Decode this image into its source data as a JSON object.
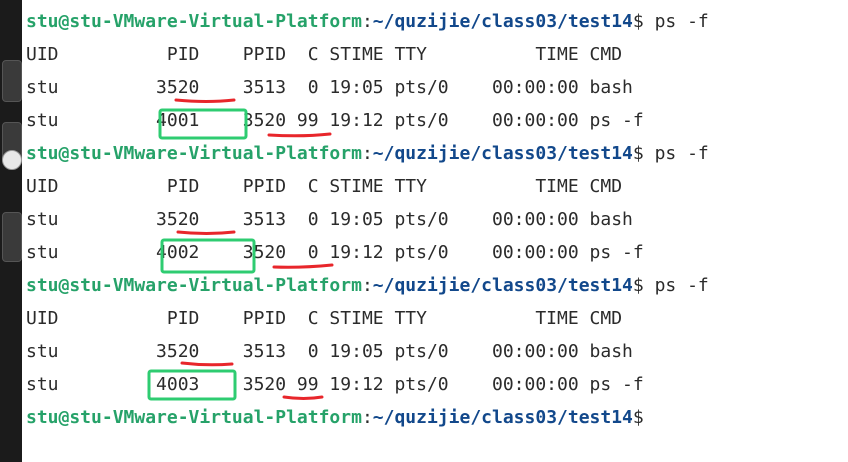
{
  "colors": {
    "background": "#ffffff",
    "text": "#2b2b2b",
    "prompt_user": "#26a269",
    "prompt_path": "#12488b",
    "underline_red": "#e8262b",
    "box_green": "#2ecc71",
    "dock": "#1b1b1b"
  },
  "prompt": {
    "user_host": "stu@stu-VMware-Virtual-Platform",
    "sep": ":",
    "path": "~/quzijie/class03/test14",
    "symbol": "$"
  },
  "blocks": [
    {
      "command": " ps -f",
      "header": "UID          PID    PPID  C STIME TTY          TIME CMD",
      "rows": [
        "stu         3520    3513  0 19:05 pts/0    00:00:00 bash",
        "stu         4001    3520 99 19:12 pts/0    00:00:00 ps -f"
      ]
    },
    {
      "command": " ps -f",
      "header": "UID          PID    PPID  C STIME TTY          TIME CMD",
      "rows": [
        "stu         3520    3513  0 19:05 pts/0    00:00:00 bash",
        "stu         4002    3520  0 19:12 pts/0    00:00:00 ps -f"
      ]
    },
    {
      "command": " ps -f",
      "header": "UID          PID    PPID  C STIME TTY          TIME CMD",
      "rows": [
        "stu         3520    3513  0 19:05 pts/0    00:00:00 bash",
        "stu         4003    3520 99 19:12 pts/0    00:00:00 ps -f"
      ]
    }
  ],
  "final_prompt_command": ""
}
